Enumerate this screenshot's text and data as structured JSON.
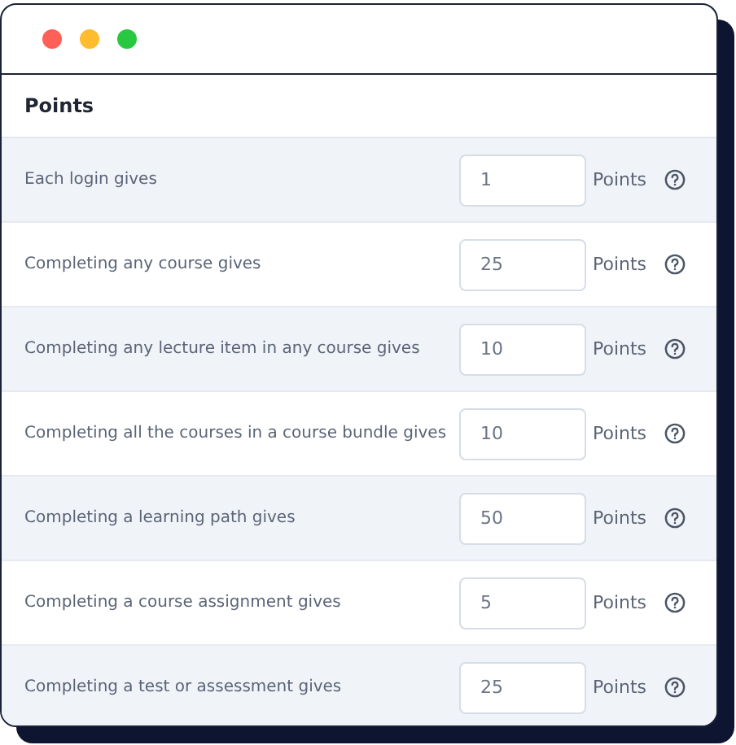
{
  "window": {
    "controls": [
      {
        "kind": "close"
      },
      {
        "kind": "minimize"
      },
      {
        "kind": "zoom"
      }
    ]
  },
  "section": {
    "title": "Points"
  },
  "rows": [
    {
      "label": "Each login gives",
      "value": "1",
      "unit": "Points"
    },
    {
      "label": "Completing any course gives",
      "value": "25",
      "unit": "Points"
    },
    {
      "label": "Completing any lecture item in any course gives",
      "value": "10",
      "unit": "Points"
    },
    {
      "label": "Completing all the courses in a course bundle gives",
      "value": "10",
      "unit": "Points"
    },
    {
      "label": "Completing a learning path gives",
      "value": "50",
      "unit": "Points"
    },
    {
      "label": "Completing a course assignment gives",
      "value": "5",
      "unit": "Points"
    },
    {
      "label": "Completing a test or assessment gives",
      "value": "25",
      "unit": "Points"
    }
  ]
}
